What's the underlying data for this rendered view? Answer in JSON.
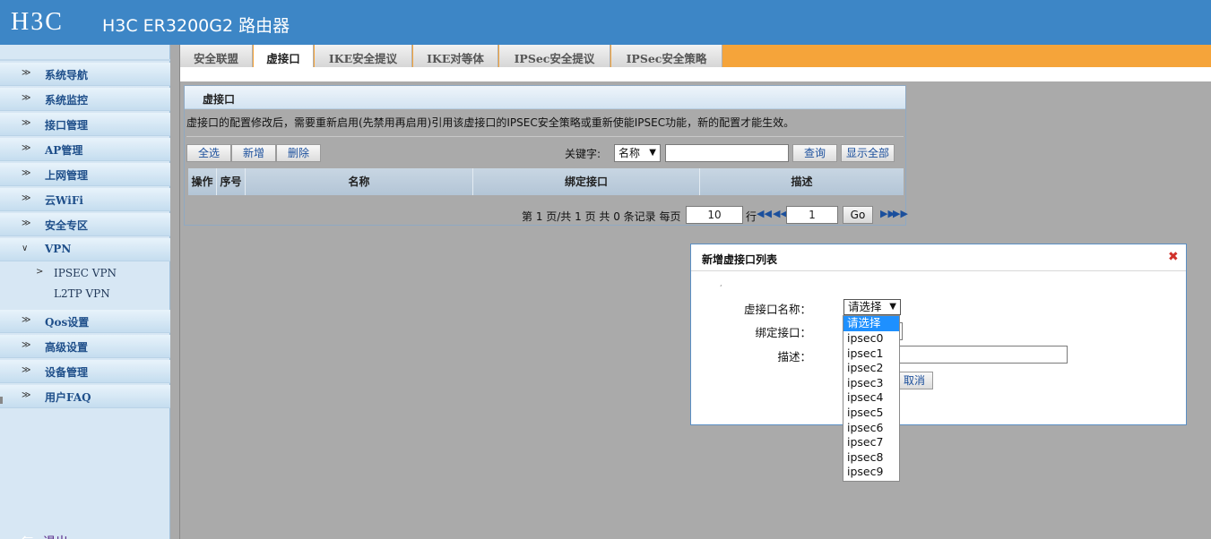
{
  "header": {
    "logo": "H3C",
    "title": "H3C ER3200G2 路由器"
  },
  "sidebar": {
    "items": [
      {
        "label": "系统导航",
        "icon": "expand-arrow-icon"
      },
      {
        "label": "系统监控",
        "icon": "expand-arrow-icon"
      },
      {
        "label": "接口管理",
        "icon": "expand-arrow-icon"
      },
      {
        "label": "AP管理",
        "icon": "expand-arrow-icon"
      },
      {
        "label": "上网管理",
        "icon": "expand-arrow-icon"
      },
      {
        "label": "云WiFi",
        "icon": "expand-arrow-icon"
      },
      {
        "label": "安全专区",
        "icon": "expand-arrow-icon"
      },
      {
        "label": "VPN",
        "icon": "collapse-arrow-icon",
        "expanded": true
      },
      {
        "label": "Qos设置",
        "icon": "expand-arrow-icon"
      },
      {
        "label": "高级设置",
        "icon": "expand-arrow-icon"
      },
      {
        "label": "设备管理",
        "icon": "expand-arrow-icon"
      },
      {
        "label": "用户FAQ",
        "icon": "expand-arrow-icon"
      }
    ],
    "vpn_sub": [
      {
        "label": "IPSEC VPN",
        "current": true
      },
      {
        "label": "L2TP VPN",
        "current": false
      }
    ],
    "logout": "退出"
  },
  "tabs": [
    {
      "label": "安全联盟",
      "active": false
    },
    {
      "label": "虚接口",
      "active": true
    },
    {
      "label": "IKE安全提议",
      "active": false
    },
    {
      "label": "IKE对等体",
      "active": false
    },
    {
      "label": "IPSec安全提议",
      "active": false
    },
    {
      "label": "IPSec安全策略",
      "active": false
    }
  ],
  "panel": {
    "title": "虚接口",
    "notice": "虚接口的配置修改后，需要重新启用(先禁用再启用)引用该虚接口的IPSEC安全策略或重新使能IPSEC功能，新的配置才能生效。",
    "buttons": {
      "select_all": "全选",
      "add": "新增",
      "delete": "删除",
      "query": "查询",
      "show_all": "显示全部"
    },
    "keyword_label": "关键字:",
    "keyword_select": "名称",
    "columns": [
      "操作",
      "序号",
      "名称",
      "绑定接口",
      "描述"
    ],
    "pager": {
      "text": "第 1 页/共 1 页 共 0 条记录 每页",
      "page_size": "10",
      "row_label": "行",
      "page": "1",
      "go": "Go"
    }
  },
  "dialog": {
    "title": "新增虚接口列表",
    "name_label": "虚接口名称：",
    "bind_label": "绑定接口：",
    "desc_label": "描述：",
    "name_value": "请选择",
    "cancel": "取消"
  },
  "dropdown": {
    "selected": "请选择",
    "options": [
      "请选择",
      "ipsec0",
      "ipsec1",
      "ipsec2",
      "ipsec3",
      "ipsec4",
      "ipsec5",
      "ipsec6",
      "ipsec7",
      "ipsec8",
      "ipsec9"
    ]
  },
  "colors": {
    "header_bg": "#3d86c6",
    "tabbar_bg": "#f5a43a",
    "link_blue": "#1b4f9c",
    "close_red": "#d0302a",
    "dropdown_selected": "#1e90ff"
  }
}
